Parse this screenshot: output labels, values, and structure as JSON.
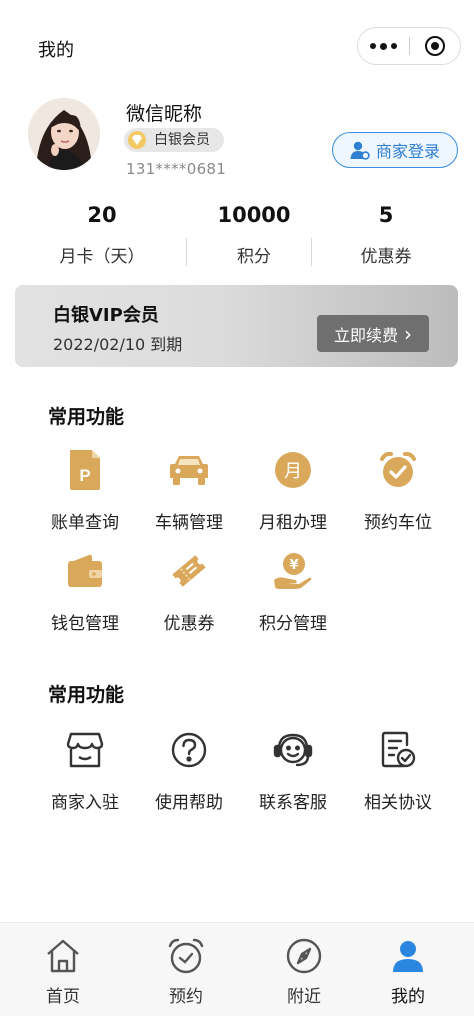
{
  "header": {
    "title": "我的"
  },
  "profile": {
    "nickname": "微信昵称",
    "level": "白银会员",
    "phone": "131****0681",
    "merchant_login": "商家登录"
  },
  "stats": [
    {
      "value": "20",
      "label": "月卡（天）"
    },
    {
      "value": "10000",
      "label": "积分"
    },
    {
      "value": "5",
      "label": "优惠券"
    }
  ],
  "vip": {
    "title": "白银VIP会员",
    "expire": "2022/02/10 到期",
    "renew": "立即续费",
    "renew_arrow": "›"
  },
  "section1": {
    "title": "常用功能",
    "items": [
      {
        "label": "账单查询",
        "icon": "parking-bill-icon"
      },
      {
        "label": "车辆管理",
        "icon": "car-icon"
      },
      {
        "label": "月租办理",
        "icon": "month-icon"
      },
      {
        "label": "预约车位",
        "icon": "alarm-clock-icon"
      },
      {
        "label": "钱包管理",
        "icon": "wallet-icon"
      },
      {
        "label": "优惠券",
        "icon": "coupon-icon"
      },
      {
        "label": "积分管理",
        "icon": "points-hand-icon"
      }
    ]
  },
  "section2": {
    "title": "常用功能",
    "items": [
      {
        "label": "商家入驻",
        "icon": "store-icon"
      },
      {
        "label": "使用帮助",
        "icon": "help-icon"
      },
      {
        "label": "联系客服",
        "icon": "headset-icon"
      },
      {
        "label": "相关协议",
        "icon": "agreement-icon"
      }
    ]
  },
  "tabbar": [
    {
      "label": "首页",
      "icon": "home-icon"
    },
    {
      "label": "预约",
      "icon": "alarm-icon"
    },
    {
      "label": "附近",
      "icon": "compass-icon"
    },
    {
      "label": "我的",
      "icon": "user-icon",
      "active": true
    }
  ],
  "colors": {
    "gold": "#d9a85a",
    "accent_blue": "#2f7fd3",
    "active_tab": "#2b86e0"
  }
}
